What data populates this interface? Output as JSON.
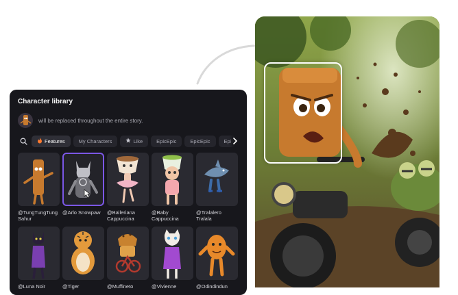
{
  "library": {
    "title": "Character library",
    "replace_text": "will be replaced throughout the entire story.",
    "tabs": [
      {
        "label": "Features",
        "icon": "fire-icon",
        "active": true
      },
      {
        "label": "My Characters",
        "active": false
      },
      {
        "label": "Like",
        "icon": "star-icon",
        "active": false
      },
      {
        "label": "EpicEpic",
        "active": false
      },
      {
        "label": "EpicEpic",
        "active": false
      },
      {
        "label": "Epi",
        "active": false
      }
    ],
    "characters": [
      {
        "name": "@TungTungTung Sahur",
        "selected": false
      },
      {
        "name": "@Arlo Snowpaw",
        "selected": true
      },
      {
        "name": "@Balleriana Cappuccina",
        "selected": false
      },
      {
        "name": "@Baby Cappuccina",
        "selected": false
      },
      {
        "name": "@Tralalero Tralala",
        "selected": false
      },
      {
        "name": "@Luna Noir",
        "selected": false
      },
      {
        "name": "@Tiger",
        "selected": false
      },
      {
        "name": "@Muffineto",
        "selected": false
      },
      {
        "name": "@Vivienne",
        "selected": false
      },
      {
        "name": "@Odindindun",
        "selected": false
      }
    ]
  },
  "colors": {
    "panel_bg": "#17171c",
    "accent_selected": "#7b57e6",
    "thumb_bg": "#2a2a31"
  }
}
